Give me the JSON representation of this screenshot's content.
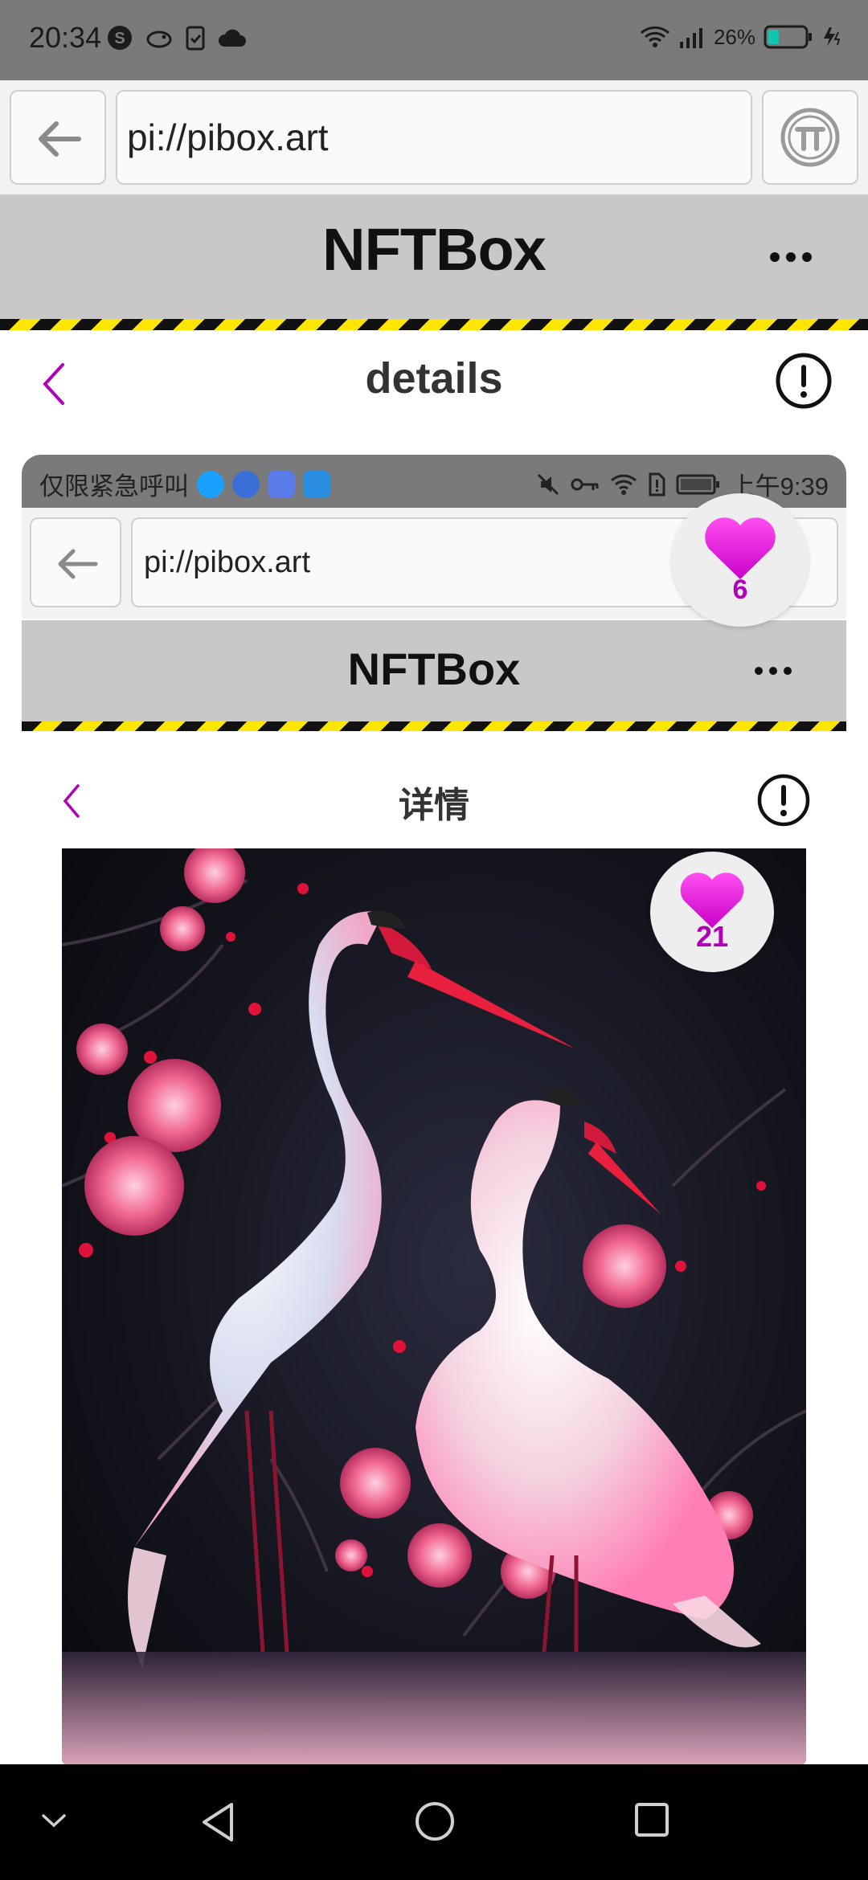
{
  "status_bar": {
    "time": "20:34",
    "battery": "26%",
    "icons": [
      "s-circle-icon",
      "bird-icon",
      "clipboard-check-icon",
      "cloud-icon",
      "wifi-icon",
      "signal-icon",
      "battery-icon",
      "charging-icon"
    ]
  },
  "browser": {
    "url": "pi://pibox.art",
    "back_icon": "back-arrow-icon",
    "pi_icon": "pi-logo-icon"
  },
  "app": {
    "title": "NFTBox",
    "menu_icon": "more-dots-icon"
  },
  "details_header": {
    "title": "details",
    "back_icon": "chevron-left-icon",
    "info_icon": "info-circle-icon"
  },
  "embedded": {
    "status_left": "仅限紧急呼叫",
    "status_time": "上午9:39",
    "url": "pi://pibox.art",
    "app_title": "NFTBox",
    "details_title": "详情",
    "floating_like_count": "6",
    "art_like_count": "21"
  },
  "colors": {
    "accent": "#b000b8",
    "heart_top": "#ff4ff0",
    "heart_bottom": "#c800c8",
    "hazard_yellow": "#ffe600",
    "header_gray": "#c8c8c8"
  },
  "nav_bar": {
    "icons": [
      "collapse-chevron-icon",
      "nav-back-icon",
      "nav-home-icon",
      "nav-recents-icon"
    ]
  }
}
